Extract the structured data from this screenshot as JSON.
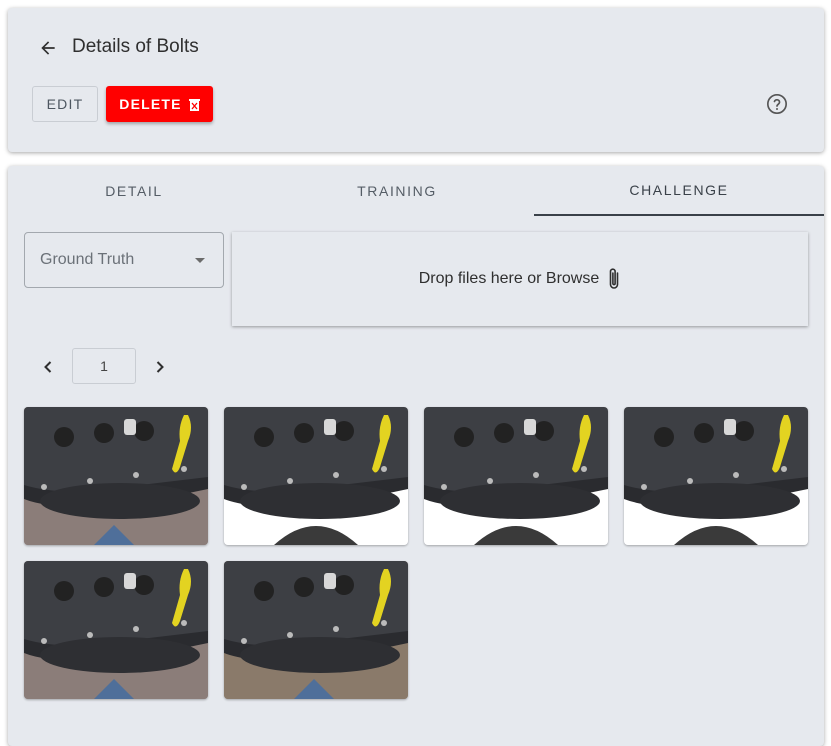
{
  "header": {
    "title": "Details of Bolts",
    "edit_label": "EDIT",
    "delete_label": "DELETE"
  },
  "tabs": [
    {
      "label": "DETAIL",
      "active": false
    },
    {
      "label": "TRAINING",
      "active": false
    },
    {
      "label": "CHALLENGE",
      "active": true
    }
  ],
  "challenge": {
    "select_value": "Ground Truth",
    "dropzone_text": "Drop files here or Browse",
    "page_number": "1",
    "images": [
      {
        "icon": "engine-photo"
      },
      {
        "icon": "engine-photo"
      },
      {
        "icon": "engine-photo"
      },
      {
        "icon": "engine-photo"
      },
      {
        "icon": "engine-photo"
      },
      {
        "icon": "engine-photo"
      }
    ]
  },
  "colors": {
    "delete": "#ff0000",
    "background": "#e6e9ee",
    "active_tab": "#3a4149"
  }
}
